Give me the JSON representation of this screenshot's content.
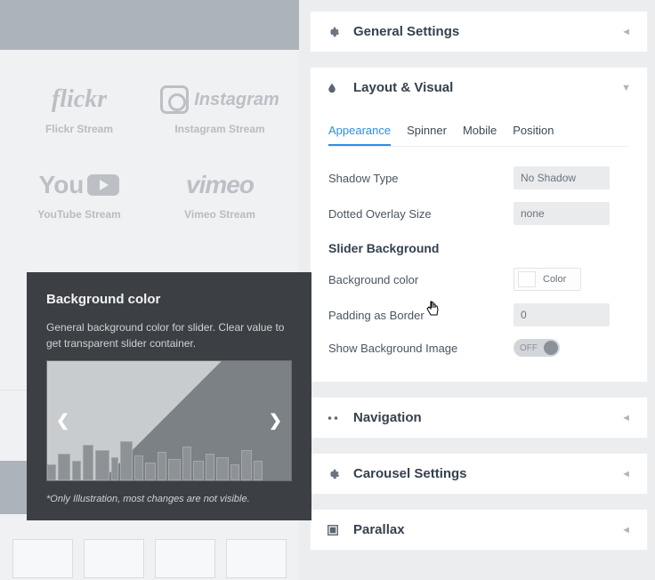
{
  "streams": {
    "flickr": {
      "logo": "flickr",
      "label": "Flickr Stream"
    },
    "instagram": {
      "logo": "Instagram",
      "label": "Instagram Stream"
    },
    "youtube": {
      "logo_a": "You",
      "logo_b": "Tube",
      "label": "YouTube Stream"
    },
    "vimeo": {
      "logo": "vimeo",
      "label": "Vimeo Stream"
    }
  },
  "tooltip": {
    "title": "Background color",
    "desc": "General background color for slider. Clear value to get transparent slider container.",
    "note": "*Only Illustration, most changes are not visible."
  },
  "accordion": {
    "general": "General Settings",
    "layout": "Layout & Visual",
    "navigation": "Navigation",
    "carousel": "Carousel Settings",
    "parallax": "Parallax"
  },
  "tabs": [
    "Appearance",
    "Spinner",
    "Mobile",
    "Position"
  ],
  "fields": {
    "shadow_label": "Shadow Type",
    "shadow_value": "No Shadow",
    "overlay_label": "Dotted Overlay Size",
    "overlay_value": "none",
    "section_bg": "Slider Background",
    "bgcolor_label": "Background color",
    "color_btn": "Color",
    "padding_label": "Padding as Border",
    "padding_value": "0",
    "showbg_label": "Show Background Image",
    "toggle_off": "OFF"
  }
}
